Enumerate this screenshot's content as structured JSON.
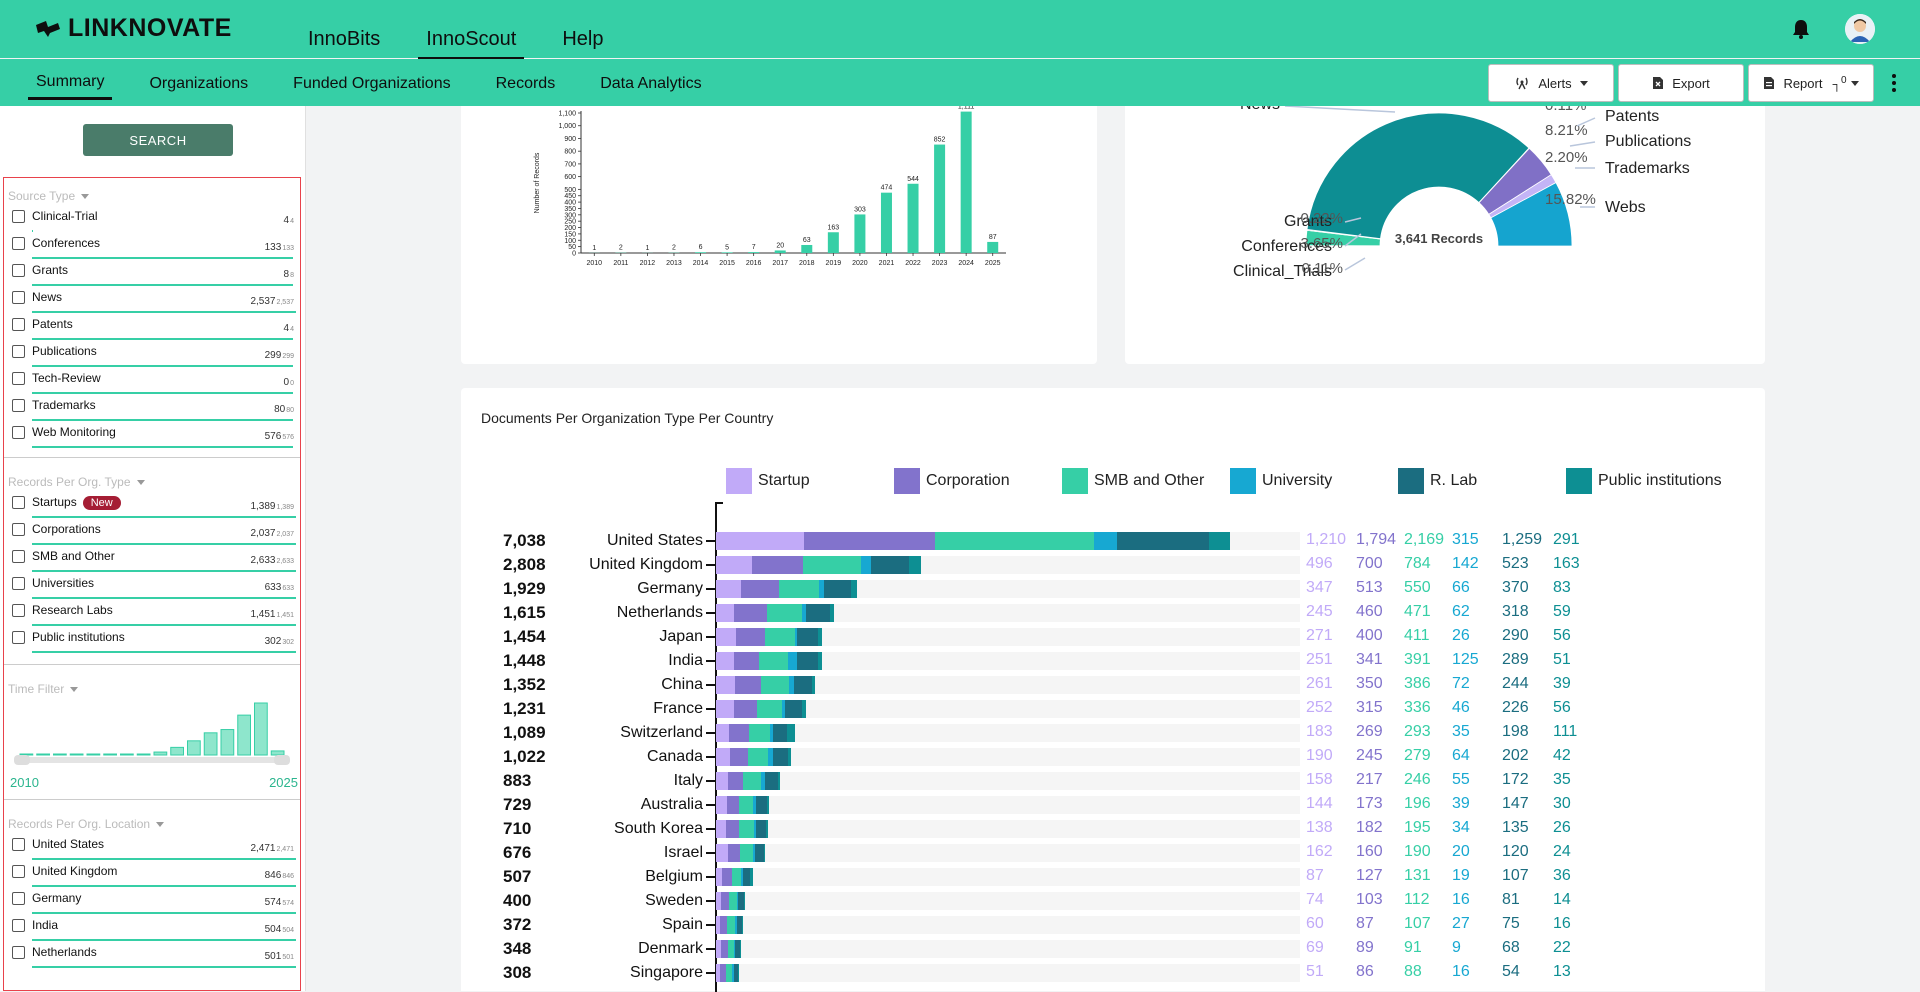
{
  "app": {
    "logo": "LINKNOVATE"
  },
  "main_nav": [
    "InnoBits",
    "InnoScout",
    "Help"
  ],
  "main_nav_active": "InnoScout",
  "sub_nav": [
    "Summary",
    "Organizations",
    "Funded Organizations",
    "Records",
    "Data Analytics"
  ],
  "sub_nav_active": "Summary",
  "actions": {
    "alerts": "Alerts",
    "export": "Export",
    "report": "Report",
    "report_count": "0"
  },
  "sidebar": {
    "search_label": "SEARCH",
    "source_type": {
      "title": "Source Type",
      "items": [
        {
          "label": "Clinical-Trial",
          "count": "4",
          "sub": "4",
          "fill": 0.005
        },
        {
          "label": "Conferences",
          "count": "133",
          "sub": "133",
          "fill": 0.99
        },
        {
          "label": "Grants",
          "count": "8",
          "sub": "8",
          "fill": 0.99
        },
        {
          "label": "News",
          "count": "2,537",
          "sub": "2,537",
          "fill": 1
        },
        {
          "label": "Patents",
          "count": "4",
          "sub": "4",
          "fill": 0.99
        },
        {
          "label": "Publications",
          "count": "299",
          "sub": "299",
          "fill": 0.99
        },
        {
          "label": "Tech-Review",
          "count": "0",
          "sub": "0",
          "fill": 0.99
        },
        {
          "label": "Trademarks",
          "count": "80",
          "sub": "80",
          "fill": 0.99
        },
        {
          "label": "Web Monitoring",
          "count": "576",
          "sub": "576",
          "fill": 0.99
        }
      ]
    },
    "org_type": {
      "title": "Records Per Org. Type",
      "new_badge": "New",
      "items": [
        {
          "label": "Startups",
          "count": "1,389",
          "sub": "1,389",
          "fill": 1
        },
        {
          "label": "Corporations",
          "count": "2,037",
          "sub": "2,037",
          "fill": 1
        },
        {
          "label": "SMB and Other",
          "count": "2,633",
          "sub": "2,633",
          "fill": 1
        },
        {
          "label": "Universities",
          "count": "633",
          "sub": "633",
          "fill": 1
        },
        {
          "label": "Research Labs",
          "count": "1,451",
          "sub": "1,451",
          "fill": 1
        },
        {
          "label": "Public institutions",
          "count": "302",
          "sub": "302",
          "fill": 1
        }
      ]
    },
    "time_filter": {
      "title": "Time Filter",
      "start": "2010",
      "end": "2025",
      "bars": [
        1,
        2,
        1,
        2,
        6,
        5,
        7,
        20,
        63,
        163,
        303,
        474,
        544,
        852,
        1111,
        87
      ]
    },
    "location": {
      "title": "Records Per Org. Location",
      "items": [
        {
          "label": "United States",
          "count": "2,471",
          "sub": "2,471",
          "fill": 1
        },
        {
          "label": "United Kingdom",
          "count": "846",
          "sub": "846",
          "fill": 1
        },
        {
          "label": "Germany",
          "count": "574",
          "sub": "574",
          "fill": 1
        },
        {
          "label": "India",
          "count": "504",
          "sub": "504",
          "fill": 1
        },
        {
          "label": "Netherlands",
          "count": "501",
          "sub": "501",
          "fill": 1
        }
      ]
    }
  },
  "chart_data": [
    {
      "type": "bar",
      "title": "",
      "ylabel": "Number of Records",
      "xlabel": "",
      "ylim": [
        0,
        1100
      ],
      "yticks": [
        0,
        50,
        100,
        150,
        200,
        250,
        300,
        350,
        400,
        450,
        500,
        600,
        700,
        800,
        900,
        1000,
        1100
      ],
      "categories": [
        "2010",
        "2011",
        "2012",
        "2013",
        "2014",
        "2015",
        "2016",
        "2017",
        "2018",
        "2019",
        "2020",
        "2021",
        "2022",
        "2023",
        "2024",
        "2025"
      ],
      "values": [
        1,
        2,
        1,
        2,
        6,
        5,
        7,
        20,
        63,
        163,
        303,
        474,
        544,
        852,
        1111,
        87
      ],
      "value_labels": [
        "1",
        "2",
        "1",
        "2",
        "6",
        "5",
        "7",
        "20",
        "63",
        "163",
        "303",
        "474",
        "544",
        "852",
        "1,111",
        "87"
      ],
      "color": "#36cfa6"
    },
    {
      "type": "pie",
      "title": "",
      "center_label": "3,641 Records",
      "labels": [
        "Clinical_Trials",
        "Conferences",
        "Grants",
        "News",
        "Patents",
        "Publications",
        "Trademarks",
        "Webs"
      ],
      "values": [
        0.11,
        3.65,
        0.22,
        69.68,
        0.11,
        8.21,
        2.2,
        15.82
      ],
      "pct_labels": [
        "0.11%",
        "3.65%",
        "0.22%",
        "",
        "0.11%",
        "8.21%",
        "2.20%",
        "15.82%"
      ],
      "colors": [
        "#2f9f8a",
        "#36cfa6",
        "#1f6f7a",
        "#0d8e93",
        "#b7a4f2",
        "#8070c6",
        "#c3b4f6",
        "#15a4cf"
      ]
    },
    {
      "type": "bar",
      "orientation": "horizontal-stacked",
      "title": "Documents Per Organization Type Per Country",
      "series_names": [
        "Startup",
        "Corporation",
        "SMB and Other",
        "University",
        "R. Lab",
        "Public institutions"
      ],
      "colors": [
        "#c1aaf8",
        "#8273cc",
        "#36cfa6",
        "#17a8d2",
        "#1b6d80",
        "#0d8f93"
      ],
      "categories": [
        "United States",
        "United Kingdom",
        "Germany",
        "Netherlands",
        "Japan",
        "India",
        "China",
        "France",
        "Switzerland",
        "Canada",
        "Italy",
        "Australia",
        "South Korea",
        "Israel",
        "Belgium",
        "Sweden",
        "Spain",
        "Denmark",
        "Singapore"
      ],
      "totals": [
        "7,038",
        "2,808",
        "1,929",
        "1,615",
        "1,454",
        "1,448",
        "1,352",
        "1,231",
        "1,089",
        "1,022",
        "883",
        "729",
        "710",
        "676",
        "507",
        "400",
        "372",
        "348",
        "308"
      ],
      "rows": [
        [
          1210,
          1794,
          2169,
          315,
          1259,
          291
        ],
        [
          496,
          700,
          784,
          142,
          523,
          163
        ],
        [
          347,
          513,
          550,
          66,
          370,
          83
        ],
        [
          245,
          460,
          471,
          62,
          318,
          59
        ],
        [
          271,
          400,
          411,
          26,
          290,
          56
        ],
        [
          251,
          341,
          391,
          125,
          289,
          51
        ],
        [
          261,
          350,
          386,
          72,
          244,
          39
        ],
        [
          252,
          315,
          336,
          46,
          226,
          56
        ],
        [
          183,
          269,
          293,
          35,
          198,
          111
        ],
        [
          190,
          245,
          279,
          64,
          202,
          42
        ],
        [
          158,
          217,
          246,
          55,
          172,
          35
        ],
        [
          144,
          173,
          196,
          39,
          147,
          30
        ],
        [
          138,
          182,
          195,
          34,
          135,
          26
        ],
        [
          162,
          160,
          190,
          20,
          120,
          24
        ],
        [
          87,
          127,
          131,
          19,
          107,
          36
        ],
        [
          74,
          103,
          112,
          16,
          81,
          14
        ],
        [
          60,
          87,
          107,
          27,
          75,
          16
        ],
        [
          69,
          89,
          91,
          9,
          68,
          22
        ],
        [
          51,
          86,
          88,
          16,
          54,
          13
        ]
      ],
      "value_labels": [
        [
          "1,210",
          "1,794",
          "2,169",
          "315",
          "1,259",
          "291"
        ],
        [
          "496",
          "700",
          "784",
          "142",
          "523",
          "163"
        ],
        [
          "347",
          "513",
          "550",
          "66",
          "370",
          "83"
        ],
        [
          "245",
          "460",
          "471",
          "62",
          "318",
          "59"
        ],
        [
          "271",
          "400",
          "411",
          "26",
          "290",
          "56"
        ],
        [
          "251",
          "341",
          "391",
          "125",
          "289",
          "51"
        ],
        [
          "261",
          "350",
          "386",
          "72",
          "244",
          "39"
        ],
        [
          "252",
          "315",
          "336",
          "46",
          "226",
          "56"
        ],
        [
          "183",
          "269",
          "293",
          "35",
          "198",
          "111"
        ],
        [
          "190",
          "245",
          "279",
          "64",
          "202",
          "42"
        ],
        [
          "158",
          "217",
          "246",
          "55",
          "172",
          "35"
        ],
        [
          "144",
          "173",
          "196",
          "39",
          "147",
          "30"
        ],
        [
          "138",
          "182",
          "195",
          "34",
          "135",
          "26"
        ],
        [
          "162",
          "160",
          "190",
          "20",
          "120",
          "24"
        ],
        [
          "87",
          "127",
          "131",
          "19",
          "107",
          "36"
        ],
        [
          "74",
          "103",
          "112",
          "16",
          "81",
          "14"
        ],
        [
          "60",
          "87",
          "107",
          "27",
          "75",
          "16"
        ],
        [
          "69",
          "89",
          "91",
          "9",
          "68",
          "22"
        ],
        [
          "51",
          "86",
          "88",
          "16",
          "54",
          "13"
        ]
      ],
      "max_total": 7038
    }
  ]
}
